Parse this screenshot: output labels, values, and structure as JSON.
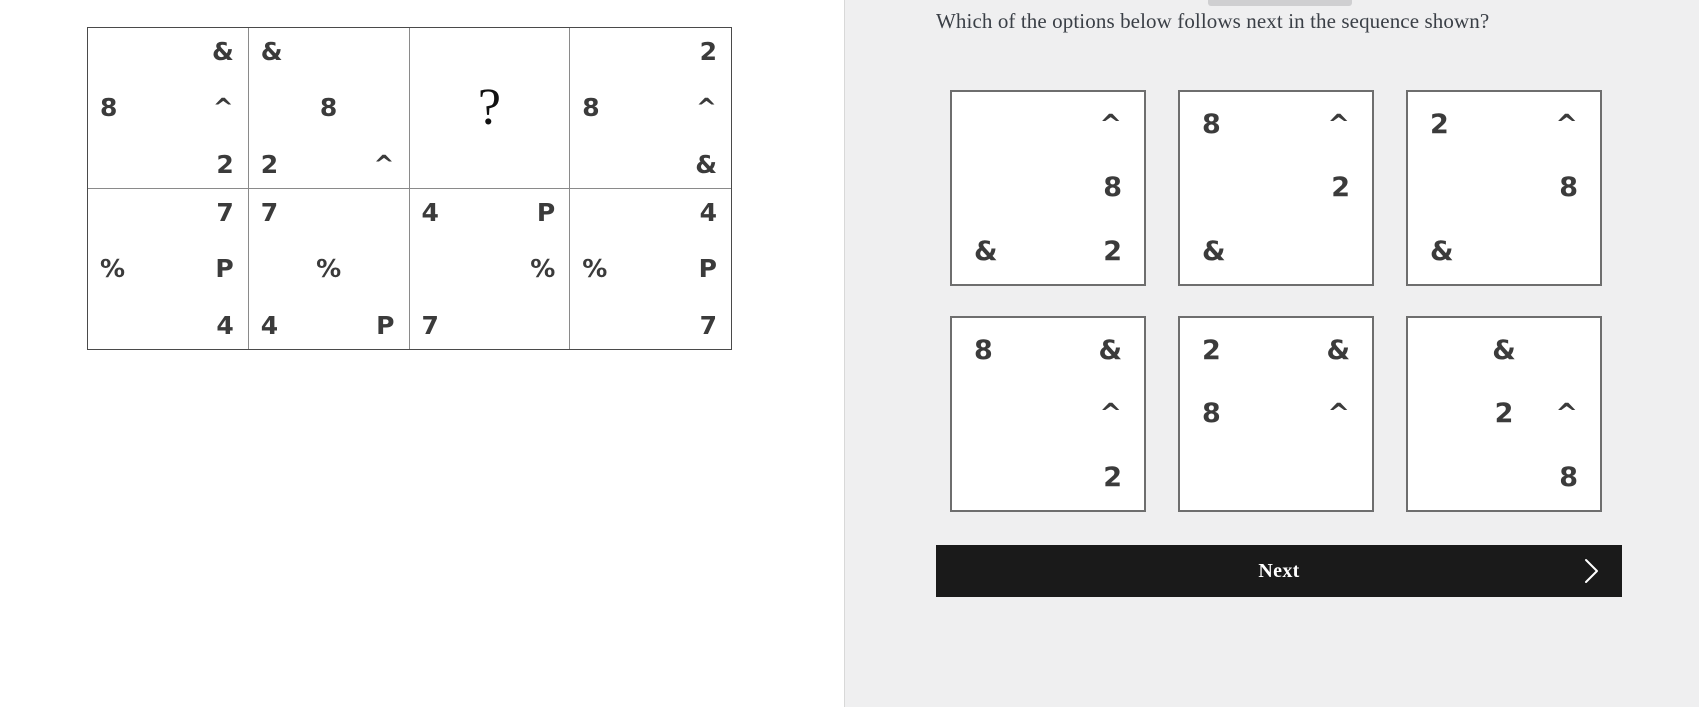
{
  "question": {
    "prompt": "Which of the options below follows next in the sequence shown?"
  },
  "sequence": {
    "cells": [
      {
        "name": "sequence-cell-1",
        "glyphs": [
          {
            "text": "8",
            "h": "left",
            "v": "mid"
          },
          {
            "text": "&",
            "h": "right",
            "v": "top"
          },
          {
            "text": "^",
            "h": "right",
            "v": "mid"
          },
          {
            "text": "2",
            "h": "right",
            "v": "bot"
          }
        ]
      },
      {
        "name": "sequence-cell-2",
        "glyphs": [
          {
            "text": "&",
            "h": "left",
            "v": "top"
          },
          {
            "text": "8",
            "h": "center",
            "v": "mid"
          },
          {
            "text": "2",
            "h": "left",
            "v": "bot"
          },
          {
            "text": "^",
            "h": "right",
            "v": "bot"
          }
        ]
      },
      {
        "name": "sequence-cell-3-unknown",
        "unknown": "?",
        "glyphs": []
      },
      {
        "name": "sequence-cell-4",
        "glyphs": [
          {
            "text": "8",
            "h": "left",
            "v": "mid"
          },
          {
            "text": "2",
            "h": "right",
            "v": "top"
          },
          {
            "text": "^",
            "h": "right",
            "v": "mid"
          },
          {
            "text": "&",
            "h": "right",
            "v": "bot"
          }
        ]
      },
      {
        "name": "sequence-cell-5",
        "glyphs": [
          {
            "text": "%",
            "h": "left",
            "v": "mid"
          },
          {
            "text": "7",
            "h": "right",
            "v": "top"
          },
          {
            "text": "P",
            "h": "right",
            "v": "mid"
          },
          {
            "text": "4",
            "h": "right",
            "v": "bot"
          }
        ]
      },
      {
        "name": "sequence-cell-6",
        "glyphs": [
          {
            "text": "7",
            "h": "left",
            "v": "top"
          },
          {
            "text": "%",
            "h": "center",
            "v": "mid"
          },
          {
            "text": "4",
            "h": "left",
            "v": "bot"
          },
          {
            "text": "P",
            "h": "right",
            "v": "bot"
          }
        ]
      },
      {
        "name": "sequence-cell-7",
        "glyphs": [
          {
            "text": "4",
            "h": "left",
            "v": "top"
          },
          {
            "text": "P",
            "h": "right",
            "v": "top"
          },
          {
            "text": "%",
            "h": "right",
            "v": "mid"
          },
          {
            "text": "7",
            "h": "left",
            "v": "bot"
          }
        ]
      },
      {
        "name": "sequence-cell-8",
        "glyphs": [
          {
            "text": "%",
            "h": "left",
            "v": "mid"
          },
          {
            "text": "4",
            "h": "right",
            "v": "top"
          },
          {
            "text": "P",
            "h": "right",
            "v": "mid"
          },
          {
            "text": "7",
            "h": "right",
            "v": "bot"
          }
        ]
      }
    ]
  },
  "options": [
    {
      "name": "option-1",
      "glyphs": [
        {
          "text": "^",
          "h": "right",
          "v": "top"
        },
        {
          "text": "8",
          "h": "right",
          "v": "mid"
        },
        {
          "text": "&",
          "h": "left",
          "v": "bot"
        },
        {
          "text": "2",
          "h": "right",
          "v": "bot"
        }
      ]
    },
    {
      "name": "option-2",
      "glyphs": [
        {
          "text": "8",
          "h": "left",
          "v": "top"
        },
        {
          "text": "^",
          "h": "right",
          "v": "top"
        },
        {
          "text": "2",
          "h": "right",
          "v": "mid"
        },
        {
          "text": "&",
          "h": "left",
          "v": "bot"
        }
      ]
    },
    {
      "name": "option-3",
      "glyphs": [
        {
          "text": "2",
          "h": "left",
          "v": "top"
        },
        {
          "text": "^",
          "h": "right",
          "v": "top"
        },
        {
          "text": "8",
          "h": "right",
          "v": "mid"
        },
        {
          "text": "&",
          "h": "left",
          "v": "bot"
        }
      ]
    },
    {
      "name": "option-4",
      "glyphs": [
        {
          "text": "8",
          "h": "left",
          "v": "top"
        },
        {
          "text": "&",
          "h": "right",
          "v": "top"
        },
        {
          "text": "^",
          "h": "right",
          "v": "mid"
        },
        {
          "text": "2",
          "h": "right",
          "v": "bot"
        }
      ]
    },
    {
      "name": "option-5",
      "glyphs": [
        {
          "text": "2",
          "h": "left",
          "v": "top"
        },
        {
          "text": "&",
          "h": "right",
          "v": "top"
        },
        {
          "text": "8",
          "h": "left",
          "v": "mid"
        },
        {
          "text": "^",
          "h": "right",
          "v": "mid"
        }
      ]
    },
    {
      "name": "option-6",
      "glyphs": [
        {
          "text": "&",
          "h": "center",
          "v": "top"
        },
        {
          "text": "2",
          "h": "center",
          "v": "mid"
        },
        {
          "text": "^",
          "h": "right",
          "v": "mid"
        },
        {
          "text": "8",
          "h": "right",
          "v": "bot"
        }
      ]
    }
  ],
  "next_button": {
    "label": "Next",
    "chevron": "chevron-right-icon"
  },
  "colors": {
    "page_background": "#ffffff",
    "panel_background": "#efeff0",
    "glyph": "#3b3b3b",
    "question_text": "#3a3f46",
    "grid_border": "#8a8a8a",
    "option_border": "#6e6e6e",
    "button_background": "#1a1a1a",
    "button_text": "#ffffff"
  }
}
